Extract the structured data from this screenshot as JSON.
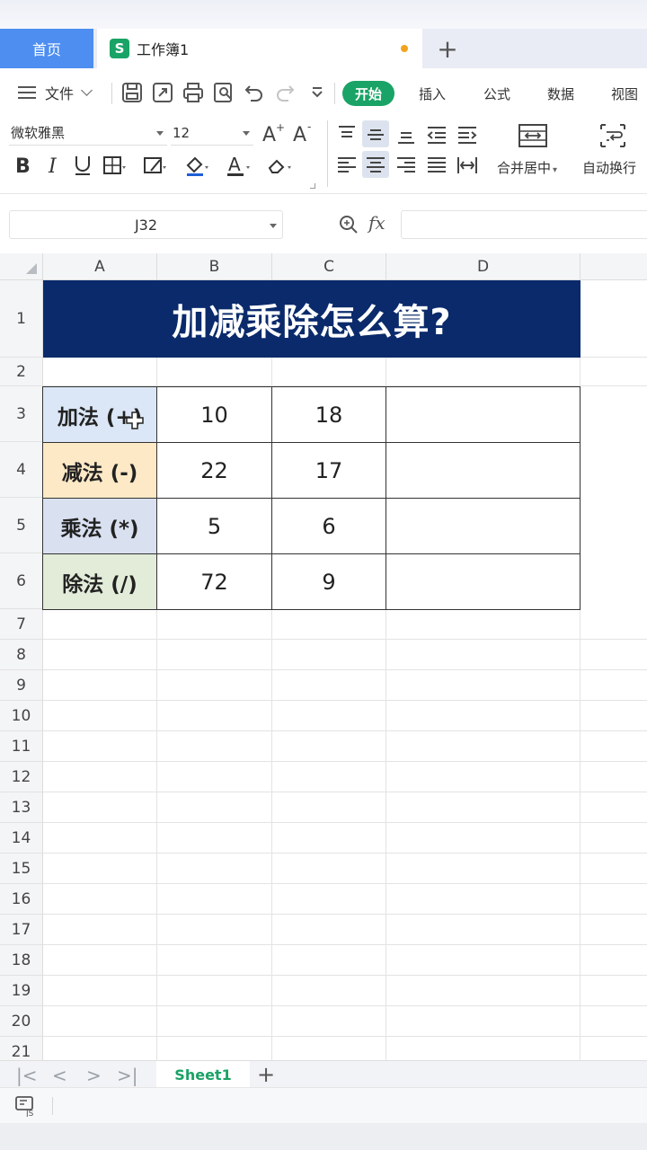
{
  "tabs": {
    "home": "首页",
    "workbook": "工作簿1",
    "add": "+",
    "s_icon": "S"
  },
  "menu": {
    "file": "文件",
    "items": [
      "开始",
      "插入",
      "公式",
      "数据",
      "视图"
    ]
  },
  "ribbon": {
    "font_name": "微软雅黑",
    "font_size": "12",
    "merge_center": "合并居中",
    "auto_wrap": "自动换行"
  },
  "formula_bar": {
    "cell_ref": "J32",
    "fx": "fx",
    "value": ""
  },
  "grid": {
    "columns": [
      "A",
      "B",
      "C",
      "D"
    ],
    "rows": [
      "1",
      "2",
      "3",
      "4",
      "5",
      "6",
      "7",
      "8",
      "9",
      "10",
      "11",
      "12",
      "13",
      "14",
      "15",
      "16",
      "17",
      "18",
      "19",
      "20",
      "21"
    ],
    "title": "加减乘除怎么算?",
    "table": [
      {
        "label": "加法 (+)",
        "b": "10",
        "c": "18",
        "d": "",
        "color": "#dbe7f6"
      },
      {
        "label": "减法 (-)",
        "b": "22",
        "c": "17",
        "d": "",
        "color": "#fde9c6"
      },
      {
        "label": "乘法 (*)",
        "b": "5",
        "c": "6",
        "d": "",
        "color": "#d9e0f0"
      },
      {
        "label": "除法 (/)",
        "b": "72",
        "c": "9",
        "d": "",
        "color": "#e2ecd9"
      }
    ]
  },
  "sheets": {
    "active": "Sheet1",
    "add": "+"
  },
  "colors": {
    "accent": "#1aa366",
    "home_tab": "#4d8ef0",
    "title_bg": "#0a2a6b"
  }
}
